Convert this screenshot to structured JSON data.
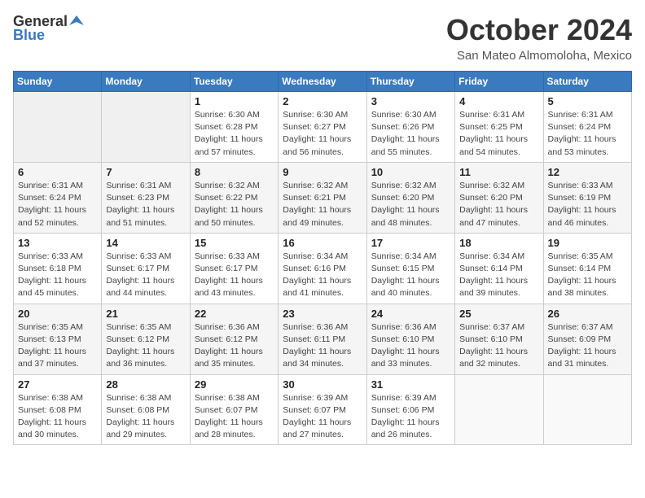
{
  "header": {
    "logo_general": "General",
    "logo_blue": "Blue",
    "month_year": "October 2024",
    "location": "San Mateo Almomoloha, Mexico"
  },
  "calendar": {
    "days_of_week": [
      "Sunday",
      "Monday",
      "Tuesday",
      "Wednesday",
      "Thursday",
      "Friday",
      "Saturday"
    ],
    "weeks": [
      [
        {
          "day": "",
          "info": ""
        },
        {
          "day": "",
          "info": ""
        },
        {
          "day": "1",
          "info": "Sunrise: 6:30 AM\nSunset: 6:28 PM\nDaylight: 11 hours and 57 minutes."
        },
        {
          "day": "2",
          "info": "Sunrise: 6:30 AM\nSunset: 6:27 PM\nDaylight: 11 hours and 56 minutes."
        },
        {
          "day": "3",
          "info": "Sunrise: 6:30 AM\nSunset: 6:26 PM\nDaylight: 11 hours and 55 minutes."
        },
        {
          "day": "4",
          "info": "Sunrise: 6:31 AM\nSunset: 6:25 PM\nDaylight: 11 hours and 54 minutes."
        },
        {
          "day": "5",
          "info": "Sunrise: 6:31 AM\nSunset: 6:24 PM\nDaylight: 11 hours and 53 minutes."
        }
      ],
      [
        {
          "day": "6",
          "info": "Sunrise: 6:31 AM\nSunset: 6:24 PM\nDaylight: 11 hours and 52 minutes."
        },
        {
          "day": "7",
          "info": "Sunrise: 6:31 AM\nSunset: 6:23 PM\nDaylight: 11 hours and 51 minutes."
        },
        {
          "day": "8",
          "info": "Sunrise: 6:32 AM\nSunset: 6:22 PM\nDaylight: 11 hours and 50 minutes."
        },
        {
          "day": "9",
          "info": "Sunrise: 6:32 AM\nSunset: 6:21 PM\nDaylight: 11 hours and 49 minutes."
        },
        {
          "day": "10",
          "info": "Sunrise: 6:32 AM\nSunset: 6:20 PM\nDaylight: 11 hours and 48 minutes."
        },
        {
          "day": "11",
          "info": "Sunrise: 6:32 AM\nSunset: 6:20 PM\nDaylight: 11 hours and 47 minutes."
        },
        {
          "day": "12",
          "info": "Sunrise: 6:33 AM\nSunset: 6:19 PM\nDaylight: 11 hours and 46 minutes."
        }
      ],
      [
        {
          "day": "13",
          "info": "Sunrise: 6:33 AM\nSunset: 6:18 PM\nDaylight: 11 hours and 45 minutes."
        },
        {
          "day": "14",
          "info": "Sunrise: 6:33 AM\nSunset: 6:17 PM\nDaylight: 11 hours and 44 minutes."
        },
        {
          "day": "15",
          "info": "Sunrise: 6:33 AM\nSunset: 6:17 PM\nDaylight: 11 hours and 43 minutes."
        },
        {
          "day": "16",
          "info": "Sunrise: 6:34 AM\nSunset: 6:16 PM\nDaylight: 11 hours and 41 minutes."
        },
        {
          "day": "17",
          "info": "Sunrise: 6:34 AM\nSunset: 6:15 PM\nDaylight: 11 hours and 40 minutes."
        },
        {
          "day": "18",
          "info": "Sunrise: 6:34 AM\nSunset: 6:14 PM\nDaylight: 11 hours and 39 minutes."
        },
        {
          "day": "19",
          "info": "Sunrise: 6:35 AM\nSunset: 6:14 PM\nDaylight: 11 hours and 38 minutes."
        }
      ],
      [
        {
          "day": "20",
          "info": "Sunrise: 6:35 AM\nSunset: 6:13 PM\nDaylight: 11 hours and 37 minutes."
        },
        {
          "day": "21",
          "info": "Sunrise: 6:35 AM\nSunset: 6:12 PM\nDaylight: 11 hours and 36 minutes."
        },
        {
          "day": "22",
          "info": "Sunrise: 6:36 AM\nSunset: 6:12 PM\nDaylight: 11 hours and 35 minutes."
        },
        {
          "day": "23",
          "info": "Sunrise: 6:36 AM\nSunset: 6:11 PM\nDaylight: 11 hours and 34 minutes."
        },
        {
          "day": "24",
          "info": "Sunrise: 6:36 AM\nSunset: 6:10 PM\nDaylight: 11 hours and 33 minutes."
        },
        {
          "day": "25",
          "info": "Sunrise: 6:37 AM\nSunset: 6:10 PM\nDaylight: 11 hours and 32 minutes."
        },
        {
          "day": "26",
          "info": "Sunrise: 6:37 AM\nSunset: 6:09 PM\nDaylight: 11 hours and 31 minutes."
        }
      ],
      [
        {
          "day": "27",
          "info": "Sunrise: 6:38 AM\nSunset: 6:08 PM\nDaylight: 11 hours and 30 minutes."
        },
        {
          "day": "28",
          "info": "Sunrise: 6:38 AM\nSunset: 6:08 PM\nDaylight: 11 hours and 29 minutes."
        },
        {
          "day": "29",
          "info": "Sunrise: 6:38 AM\nSunset: 6:07 PM\nDaylight: 11 hours and 28 minutes."
        },
        {
          "day": "30",
          "info": "Sunrise: 6:39 AM\nSunset: 6:07 PM\nDaylight: 11 hours and 27 minutes."
        },
        {
          "day": "31",
          "info": "Sunrise: 6:39 AM\nSunset: 6:06 PM\nDaylight: 11 hours and 26 minutes."
        },
        {
          "day": "",
          "info": ""
        },
        {
          "day": "",
          "info": ""
        }
      ]
    ]
  }
}
